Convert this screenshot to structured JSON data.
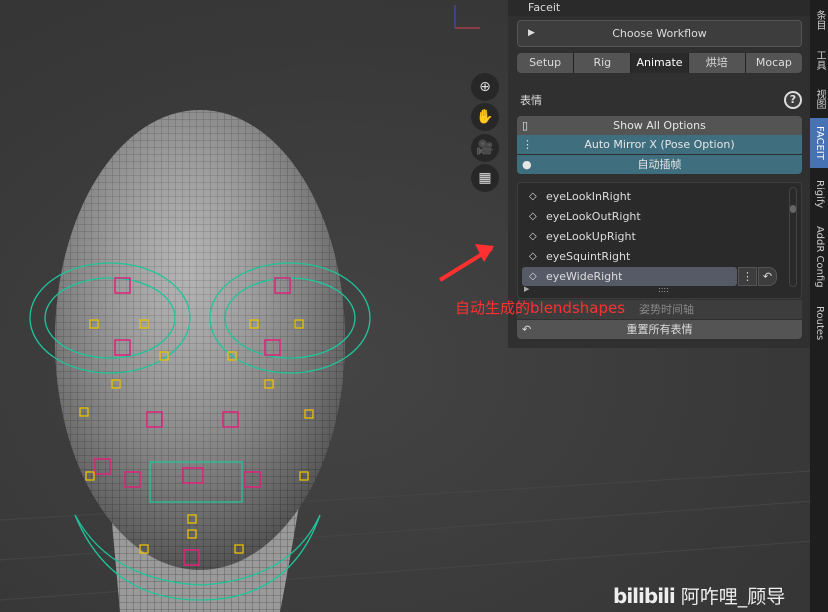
{
  "panel": {
    "header": "Faceit",
    "workflow_label": "Choose Workflow",
    "tabs": [
      "Setup",
      "Rig",
      "Animate",
      "烘培",
      "Mocap"
    ],
    "active_tab": "Animate",
    "section_title": "表情",
    "help_icon": "?",
    "show_all_options": "Show All Options",
    "auto_mirror": "Auto Mirror X (Pose Option)",
    "auto_keyframe": "自动插帧",
    "expressions": [
      "eyeLookInRight",
      "eyeLookOutRight",
      "eyeLookUpRight",
      "eyeSquintRight",
      "eyeWideRight"
    ],
    "selected_expression": "eyeWideRight",
    "grip": "::::",
    "pose_timeline": "姿势时间轴",
    "reset_all": "重置所有表情",
    "accent": "#3f6f7e"
  },
  "sidebar_tabs": [
    "条目",
    "工具",
    "视图",
    "FACEIT",
    "Rigify",
    "AddR Config",
    "Routes"
  ],
  "annotation": "自动生成的blendshapes",
  "watermark": {
    "logo": "bilibili",
    "author": "阿咋哩_顾导"
  }
}
